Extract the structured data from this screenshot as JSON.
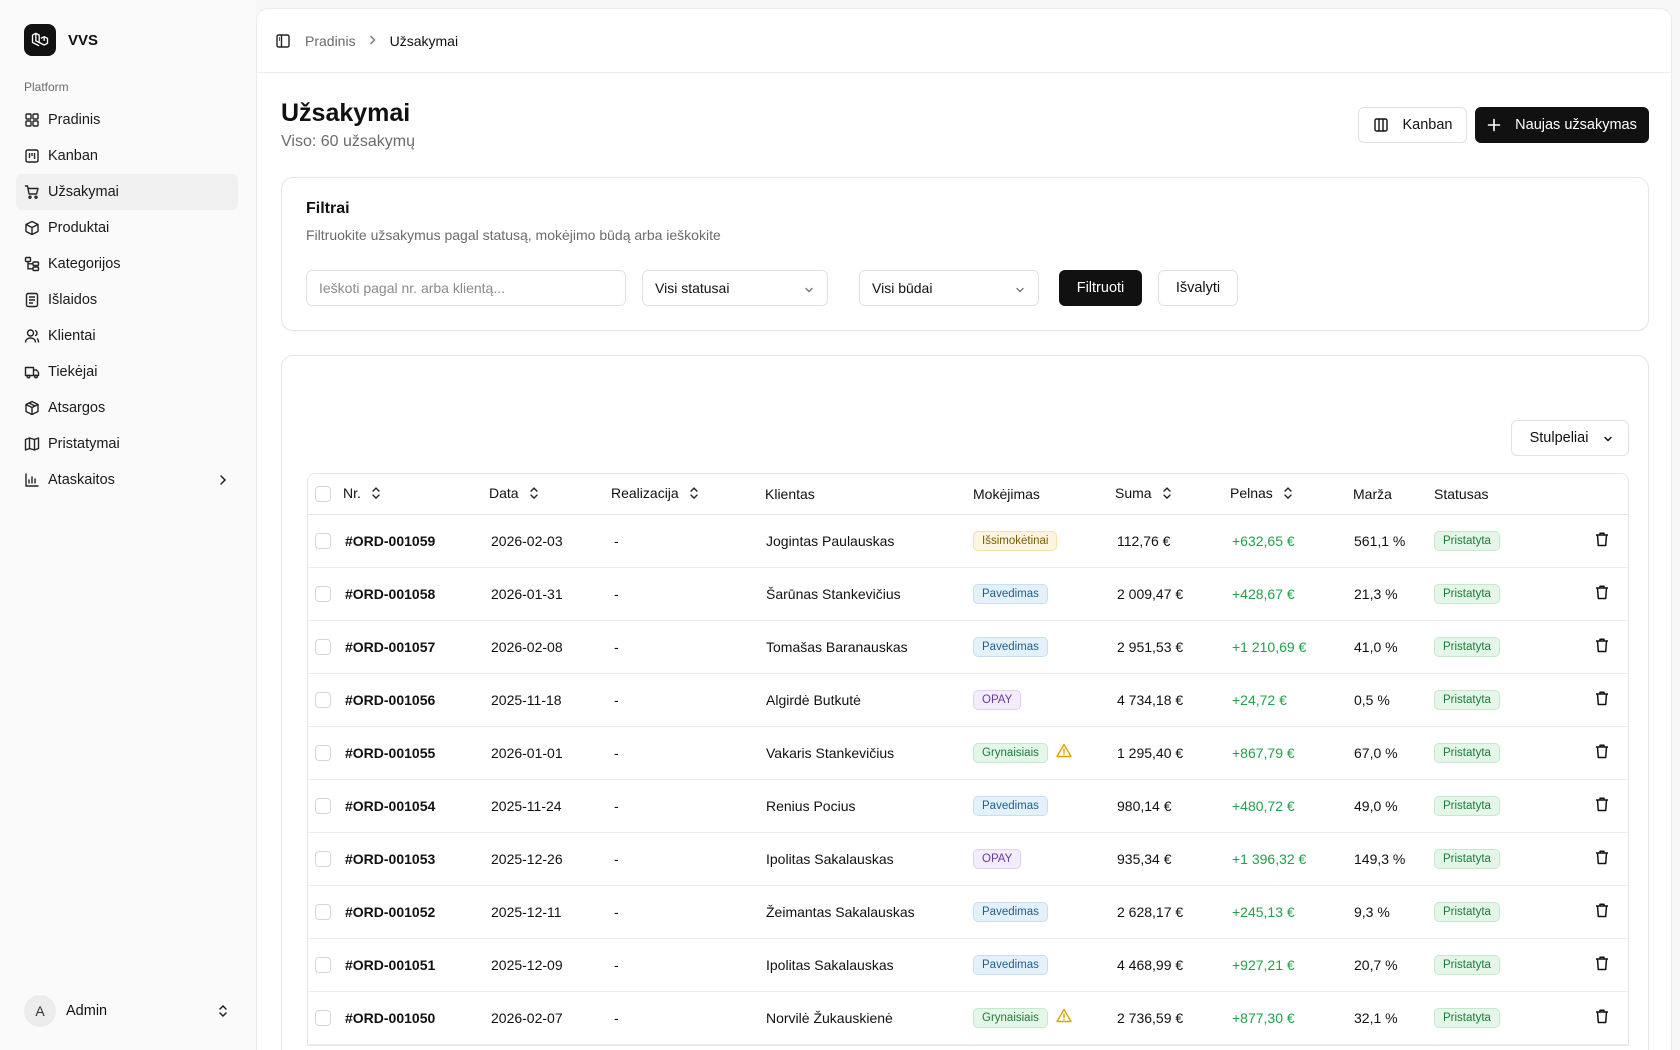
{
  "brand": {
    "name": "VVS"
  },
  "sidebar": {
    "group_label": "Platform",
    "items": [
      {
        "label": "Pradinis",
        "icon": "grid-icon"
      },
      {
        "label": "Kanban",
        "icon": "kanban-icon"
      },
      {
        "label": "Užsakymai",
        "icon": "cart-icon"
      },
      {
        "label": "Produktai",
        "icon": "box-icon"
      },
      {
        "label": "Kategorijos",
        "icon": "tree-icon"
      },
      {
        "label": "Išlaidos",
        "icon": "receipt-icon"
      },
      {
        "label": "Klientai",
        "icon": "user-icon"
      },
      {
        "label": "Tiekėjai",
        "icon": "truck-icon"
      },
      {
        "label": "Atsargos",
        "icon": "package-icon"
      },
      {
        "label": "Pristatymai",
        "icon": "map-icon"
      },
      {
        "label": "Ataskaitos",
        "icon": "chart-icon"
      }
    ],
    "active_index": 2
  },
  "user": {
    "initial": "A",
    "name": "Admin"
  },
  "breadcrumb": {
    "parent": "Pradinis",
    "current": "Užsakymai"
  },
  "page": {
    "title": "Užsakymai",
    "subtitle": "Viso: 60 užsakymų"
  },
  "actions": {
    "kanban": "Kanban",
    "new_order": "Naujas užsakymas"
  },
  "filters": {
    "title": "Filtrai",
    "description": "Filtruokite užsakymus pagal statusą, mokėjimo būdą arba ieškokite",
    "search_placeholder": "Ieškoti pagal nr. arba klientą...",
    "status_select": "Visi statusai",
    "method_select": "Visi būdai",
    "apply": "Filtruoti",
    "clear": "Išvalyti"
  },
  "table": {
    "columns_button": "Stulpeliai",
    "headers": {
      "nr": "Nr.",
      "date": "Data",
      "realization": "Realizacija",
      "client": "Klientas",
      "payment": "Mokėjimas",
      "sum": "Suma",
      "profit": "Pelnas",
      "margin": "Marža",
      "status": "Statusas"
    },
    "rows": [
      {
        "nr": "#ORD-001059",
        "date": "2026-02-03",
        "realization": "-",
        "client": "Jogintas Paulauskas",
        "payment": "Išsimokėtinai",
        "payment_style": "yellow",
        "warning": false,
        "sum": "112,76 €",
        "profit": "+632,65 €",
        "margin": "561,1 %",
        "status": "Pristatyta"
      },
      {
        "nr": "#ORD-001058",
        "date": "2026-01-31",
        "realization": "-",
        "client": "Šarūnas Stankevičius",
        "payment": "Pavedimas",
        "payment_style": "blue",
        "warning": false,
        "sum": "2 009,47 €",
        "profit": "+428,67 €",
        "margin": "21,3 %",
        "status": "Pristatyta"
      },
      {
        "nr": "#ORD-001057",
        "date": "2026-02-08",
        "realization": "-",
        "client": "Tomašas Baranauskas",
        "payment": "Pavedimas",
        "payment_style": "blue",
        "warning": false,
        "sum": "2 951,53 €",
        "profit": "+1 210,69 €",
        "margin": "41,0 %",
        "status": "Pristatyta"
      },
      {
        "nr": "#ORD-001056",
        "date": "2025-11-18",
        "realization": "-",
        "client": "Algirdė Butkutė",
        "payment": "OPAY",
        "payment_style": "purple",
        "warning": false,
        "sum": "4 734,18 €",
        "profit": "+24,72 €",
        "margin": "0,5 %",
        "status": "Pristatyta"
      },
      {
        "nr": "#ORD-001055",
        "date": "2026-01-01",
        "realization": "-",
        "client": "Vakaris Stankevičius",
        "payment": "Grynaisiais",
        "payment_style": "green",
        "warning": true,
        "sum": "1 295,40 €",
        "profit": "+867,79 €",
        "margin": "67,0 %",
        "status": "Pristatyta"
      },
      {
        "nr": "#ORD-001054",
        "date": "2025-11-24",
        "realization": "-",
        "client": "Renius Pocius",
        "payment": "Pavedimas",
        "payment_style": "blue",
        "warning": false,
        "sum": "980,14 €",
        "profit": "+480,72 €",
        "margin": "49,0 %",
        "status": "Pristatyta"
      },
      {
        "nr": "#ORD-001053",
        "date": "2025-12-26",
        "realization": "-",
        "client": "Ipolitas Sakalauskas",
        "payment": "OPAY",
        "payment_style": "purple",
        "warning": false,
        "sum": "935,34 €",
        "profit": "+1 396,32 €",
        "margin": "149,3 %",
        "status": "Pristatyta"
      },
      {
        "nr": "#ORD-001052",
        "date": "2025-12-11",
        "realization": "-",
        "client": "Žeimantas Sakalauskas",
        "payment": "Pavedimas",
        "payment_style": "blue",
        "warning": false,
        "sum": "2 628,17 €",
        "profit": "+245,13 €",
        "margin": "9,3 %",
        "status": "Pristatyta"
      },
      {
        "nr": "#ORD-001051",
        "date": "2025-12-09",
        "realization": "-",
        "client": "Ipolitas Sakalauskas",
        "payment": "Pavedimas",
        "payment_style": "blue",
        "warning": false,
        "sum": "4 468,99 €",
        "profit": "+927,21 €",
        "margin": "20,7 %",
        "status": "Pristatyta"
      },
      {
        "nr": "#ORD-001050",
        "date": "2026-02-07",
        "realization": "-",
        "client": "Norvilė Žukauskienė",
        "payment": "Grynaisiais",
        "payment_style": "green",
        "warning": true,
        "sum": "2 736,59 €",
        "profit": "+877,30 €",
        "margin": "32,1 %",
        "status": "Pristatyta"
      }
    ]
  }
}
